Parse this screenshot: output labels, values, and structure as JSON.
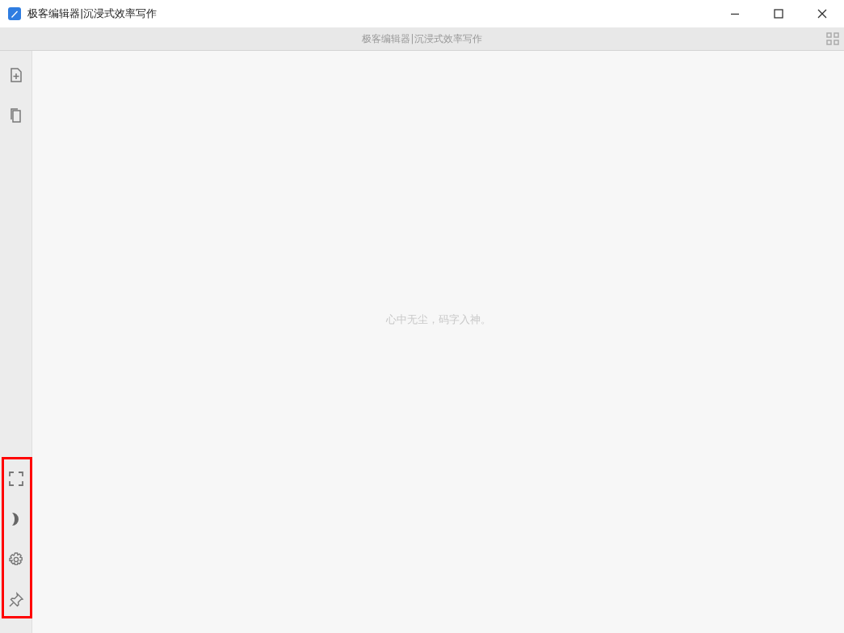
{
  "window": {
    "title": "极客编辑器|沉浸式效率写作"
  },
  "header": {
    "title": "极客编辑器|沉浸式效率写作"
  },
  "editor": {
    "placeholder": "心中无尘，码字入神。"
  }
}
